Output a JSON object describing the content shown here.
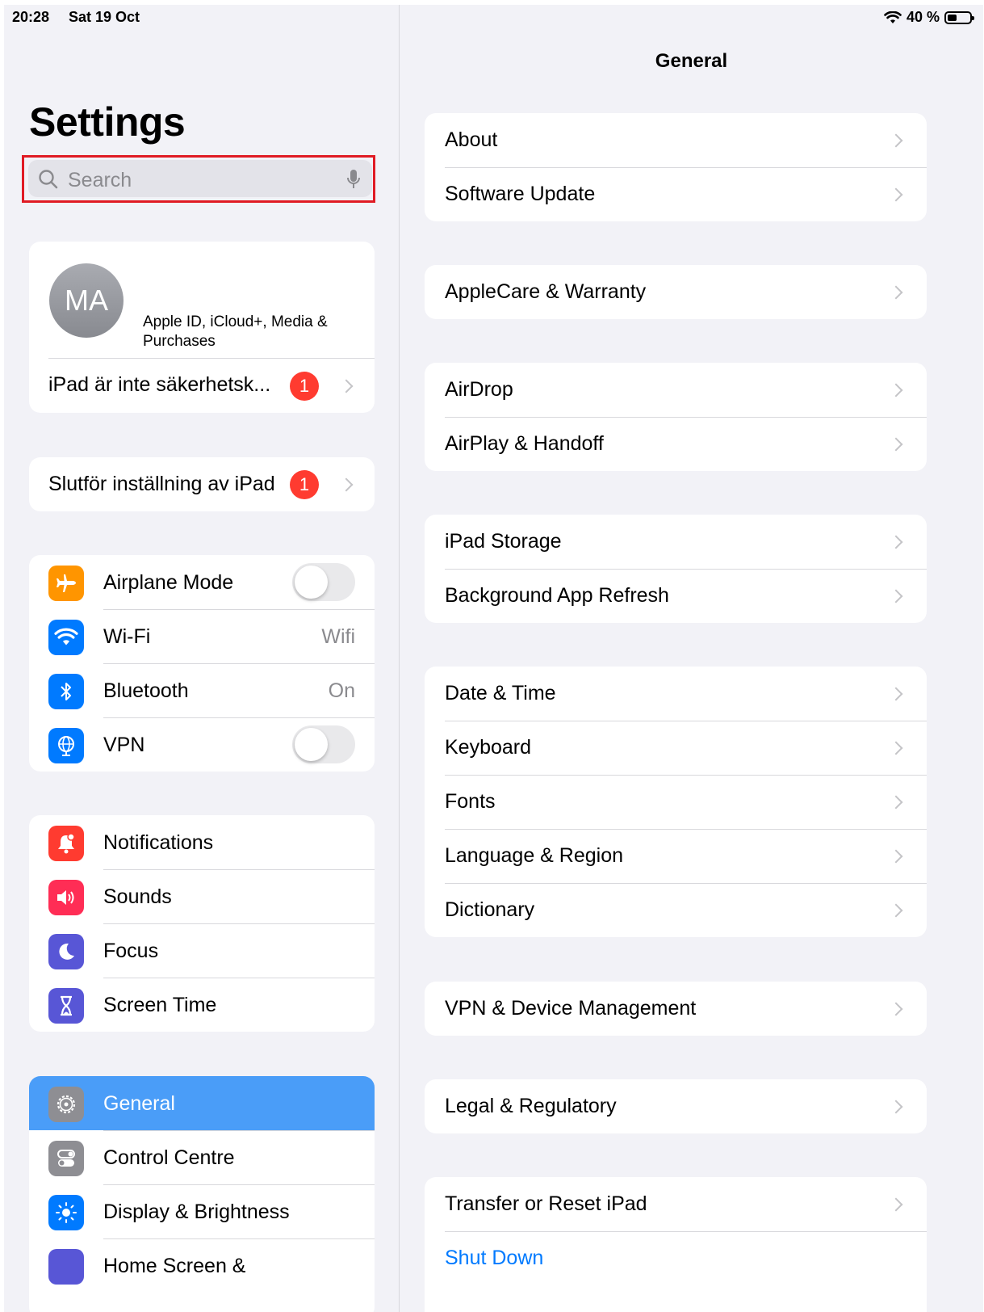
{
  "status": {
    "time": "20:28",
    "date": "Sat 19 Oct",
    "battery_pct": "40 %"
  },
  "sidebar": {
    "title": "Settings",
    "search_placeholder": "Search",
    "profile": {
      "initials": "MA",
      "subtitle": "Apple ID, iCloud+, Media & Purchases"
    },
    "alert_row": {
      "label": "iPad är inte säkerhetsk...",
      "badge": "1"
    },
    "setup_row": {
      "label": "Slutför inställning av iPad",
      "badge": "1"
    },
    "connectivity": [
      {
        "label": "Airplane Mode",
        "icon": "airplane-icon",
        "color": "#ff9500"
      },
      {
        "label": "Wi-Fi",
        "value": "Wifi",
        "icon": "wifi-icon",
        "color": "#007aff"
      },
      {
        "label": "Bluetooth",
        "value": "On",
        "icon": "bluetooth-icon",
        "color": "#007aff"
      },
      {
        "label": "VPN",
        "icon": "globe-icon",
        "color": "#007aff"
      }
    ],
    "notifications_group": [
      {
        "label": "Notifications",
        "icon": "bell-icon",
        "color": "#ff3b30"
      },
      {
        "label": "Sounds",
        "icon": "speaker-icon",
        "color": "#ff2d55"
      },
      {
        "label": "Focus",
        "icon": "moon-icon",
        "color": "#5856d6"
      },
      {
        "label": "Screen Time",
        "icon": "hourglass-icon",
        "color": "#5856d6"
      }
    ],
    "general_group": [
      {
        "label": "General",
        "icon": "gear-icon",
        "color": "#8e8e93",
        "selected": true
      },
      {
        "label": "Control Centre",
        "icon": "switches-icon",
        "color": "#8e8e93"
      },
      {
        "label": "Display & Brightness",
        "icon": "sun-icon",
        "color": "#007aff"
      },
      {
        "label": "Home Screen &",
        "icon": "grid-icon",
        "color": "#5856d6"
      }
    ]
  },
  "detail": {
    "title": "General",
    "groups": [
      [
        "About",
        "Software Update"
      ],
      [
        "AppleCare & Warranty"
      ],
      [
        "AirDrop",
        "AirPlay & Handoff"
      ],
      [
        "iPad Storage",
        "Background App Refresh"
      ],
      [
        "Date & Time",
        "Keyboard",
        "Fonts",
        "Language & Region",
        "Dictionary"
      ],
      [
        "VPN & Device Management"
      ],
      [
        "Legal & Regulatory"
      ],
      [
        "Transfer or Reset iPad",
        "Shut Down"
      ]
    ]
  }
}
